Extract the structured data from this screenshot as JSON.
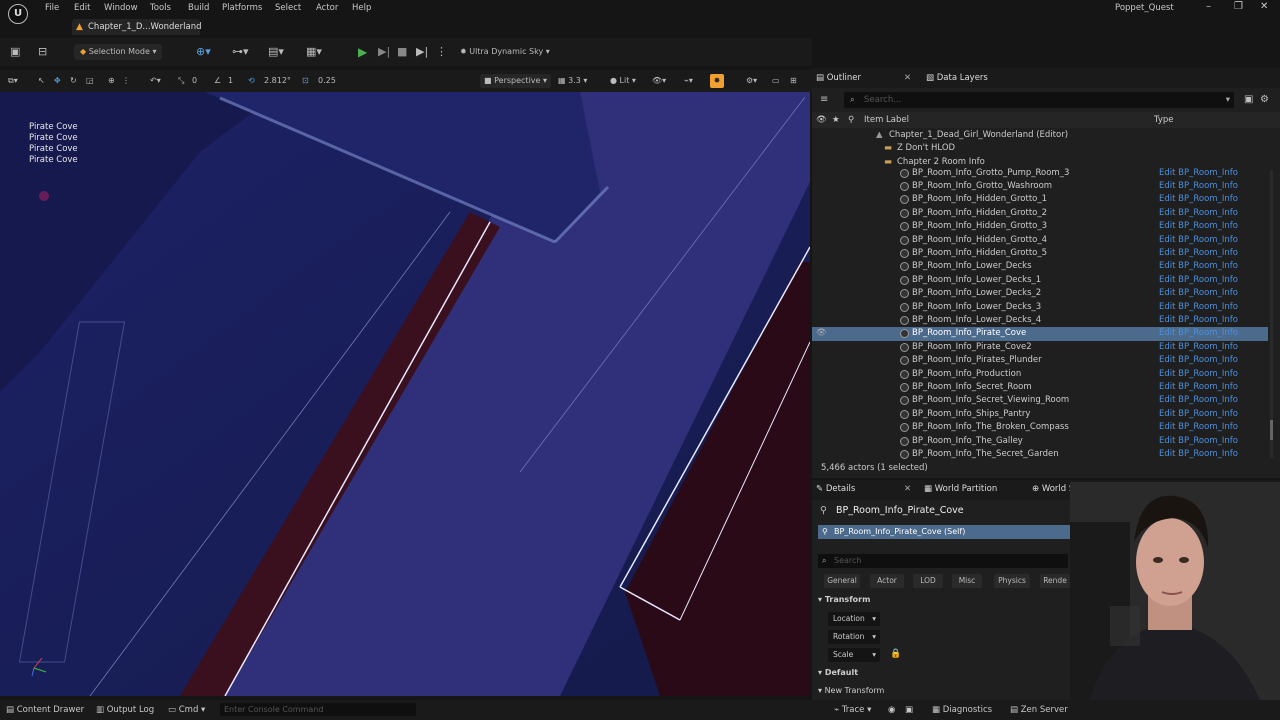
{
  "menubar": {
    "items": [
      "File",
      "Edit",
      "Window",
      "Tools",
      "Build",
      "Platforms",
      "Select",
      "Actor",
      "Help"
    ],
    "project": "Poppet_Quest"
  },
  "tab": {
    "label": "Chapter_1_D...Wonderland"
  },
  "toolbar": {
    "mode_label": "Selection Mode",
    "sky_label": "Ultra Dynamic Sky"
  },
  "viewport_toolbar": {
    "angle": "1",
    "rotation_value": "2.812°",
    "scale_value": "0.25",
    "grid_value": "0",
    "perspective_label": "Perspective",
    "speed_value": "3.3",
    "lit_label": "Lit"
  },
  "viewport": {
    "overlay_labels": [
      "Pirate Cove",
      "Pirate Cove",
      "Pirate Cove",
      "Pirate Cove"
    ]
  },
  "outliner": {
    "tab_outliner": "Outliner",
    "tab_layers": "Data Layers",
    "search_placeholder": "Search...",
    "col_label": "Item Label",
    "col_type": "Type",
    "tree": [
      {
        "label": "Chapter_1_Dead_Girl_Wonderland (Editor)"
      },
      {
        "label": "Z Don't HLOD"
      },
      {
        "label": "Chapter 2 Room Info"
      }
    ],
    "rows": [
      {
        "label": "BP_Room_Info_Grotto_Pump_Room_3",
        "type": "Edit BP_Room_Info"
      },
      {
        "label": "BP_Room_Info_Grotto_Washroom",
        "type": "Edit BP_Room_Info"
      },
      {
        "label": "BP_Room_Info_Hidden_Grotto_1",
        "type": "Edit BP_Room_Info"
      },
      {
        "label": "BP_Room_Info_Hidden_Grotto_2",
        "type": "Edit BP_Room_Info"
      },
      {
        "label": "BP_Room_Info_Hidden_Grotto_3",
        "type": "Edit BP_Room_Info"
      },
      {
        "label": "BP_Room_Info_Hidden_Grotto_4",
        "type": "Edit BP_Room_Info"
      },
      {
        "label": "BP_Room_Info_Hidden_Grotto_5",
        "type": "Edit BP_Room_Info"
      },
      {
        "label": "BP_Room_Info_Lower_Decks",
        "type": "Edit BP_Room_Info"
      },
      {
        "label": "BP_Room_Info_Lower_Decks_1",
        "type": "Edit BP_Room_Info"
      },
      {
        "label": "BP_Room_Info_Lower_Decks_2",
        "type": "Edit BP_Room_Info"
      },
      {
        "label": "BP_Room_Info_Lower_Decks_3",
        "type": "Edit BP_Room_Info"
      },
      {
        "label": "BP_Room_Info_Lower_Decks_4",
        "type": "Edit BP_Room_Info"
      },
      {
        "label": "BP_Room_Info_Pirate_Cove",
        "type": "Edit BP_Room_Info",
        "selected": true
      },
      {
        "label": "BP_Room_Info_Pirate_Cove2",
        "type": "Edit BP_Room_Info"
      },
      {
        "label": "BP_Room_Info_Pirates_Plunder",
        "type": "Edit BP_Room_Info"
      },
      {
        "label": "BP_Room_Info_Production",
        "type": "Edit BP_Room_Info"
      },
      {
        "label": "BP_Room_Info_Secret_Room",
        "type": "Edit BP_Room_Info"
      },
      {
        "label": "BP_Room_Info_Secret_Viewing_Room",
        "type": "Edit BP_Room_Info"
      },
      {
        "label": "BP_Room_Info_Ships_Pantry",
        "type": "Edit BP_Room_Info"
      },
      {
        "label": "BP_Room_Info_The_Broken_Compass",
        "type": "Edit BP_Room_Info"
      },
      {
        "label": "BP_Room_Info_The_Galley",
        "type": "Edit BP_Room_Info"
      },
      {
        "label": "BP_Room_Info_The_Secret_Garden",
        "type": "Edit BP_Room_Info"
      }
    ],
    "actor_count": "5,466 actors (1 selected)"
  },
  "details": {
    "tab_details": "Details",
    "tab_world_partition": "World Partition",
    "tab_world_settings": "World Settings",
    "actor_name": "BP_Room_Info_Pirate_Cove",
    "self_label": "BP_Room_Info_Pirate_Cove (Self)",
    "search_placeholder": "Search",
    "categories": [
      "General",
      "Actor",
      "LOD",
      "Misc",
      "Physics",
      "Rende"
    ],
    "section_transform": "Transform",
    "props": [
      "Location",
      "Rotation",
      "Scale"
    ],
    "section_default": "Default",
    "section_new_transform": "New Transform"
  },
  "bottombar": {
    "content_drawer": "Content Drawer",
    "output_log": "Output Log",
    "cmd": "Cmd",
    "console_placeholder": "Enter Console Command",
    "trace": "Trace",
    "diagnostics": "Diagnostics",
    "zen_server": "Zen Server"
  }
}
